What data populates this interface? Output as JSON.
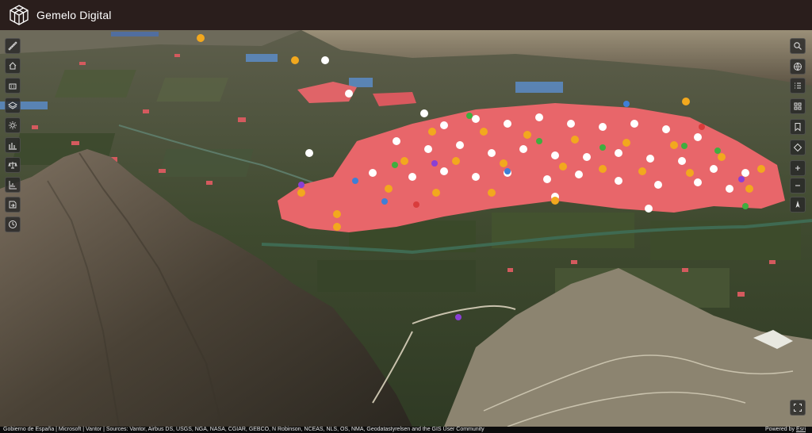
{
  "app": {
    "title": "Gemelo Digital"
  },
  "footer": {
    "attribution": "Gobierno de España | Microsoft | Vantor | Sources: Vantor, Airbus DS, USGS, NGA, NASA, CGIAR, GEBCO, N Robinson, NCEAS, NLS, OS, NMA, Geodatastyrelsen and the GIS User Community",
    "powered_by": "Powered by",
    "powered_link": "Esri"
  },
  "left_toolbar": [
    "ruler-icon",
    "home-icon",
    "building-icon",
    "layers-icon",
    "sun-icon",
    "bar-chart-icon",
    "balance-icon",
    "column-chart-icon",
    "export-icon",
    "clock-icon"
  ],
  "right_toolbar": [
    "search-icon",
    "globe-icon",
    "list-icon",
    "grid-icon",
    "bookmark-icon",
    "compass-diamond-icon",
    "zoom-in-icon",
    "zoom-out-icon",
    "north-arrow-icon"
  ],
  "colors": {
    "header_bg": "#2a1e1c",
    "buildings": "#e8666a",
    "farmland": "#3d4a2a",
    "mountain": "#6b5d48"
  }
}
